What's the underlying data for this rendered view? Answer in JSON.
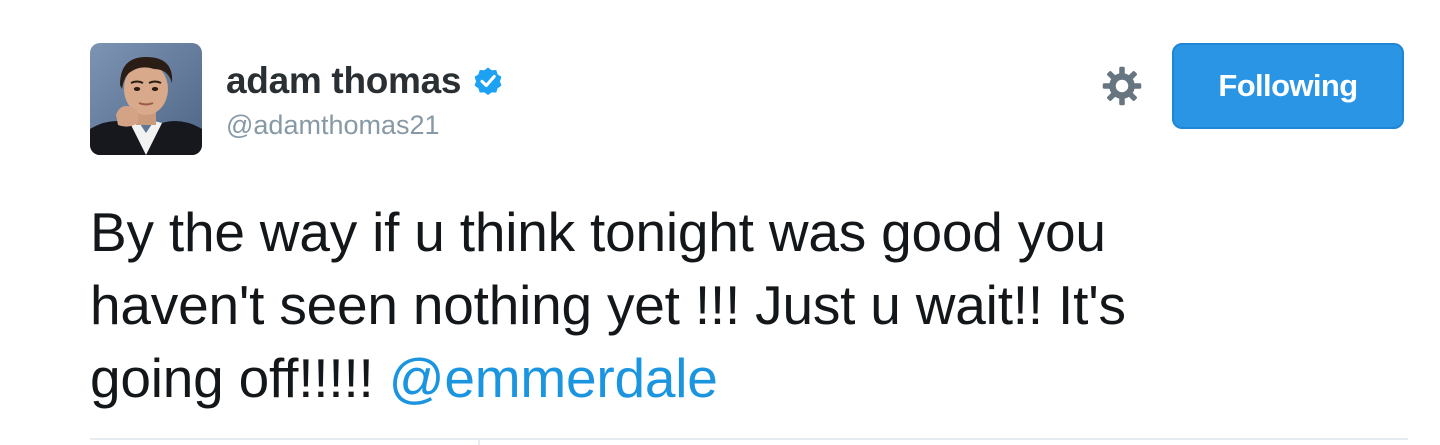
{
  "tweet": {
    "author": {
      "display_name": "adam thomas",
      "screen_name": "@adamthomas21",
      "verified": true,
      "avatar": "profile-photo"
    },
    "follow_button_label": "Following",
    "settings_icon": "gear-icon",
    "text_lines": [
      "By the way if u think tonight was good you",
      "haven't seen nothing yet !!! Just u wait!! It's",
      "going off!!!!! "
    ],
    "mention": "@emmerdale"
  },
  "colors": {
    "link": "#1b95e0",
    "button": "#2b95e5",
    "verified": "#1da1f2",
    "muted": "#8899a6"
  }
}
